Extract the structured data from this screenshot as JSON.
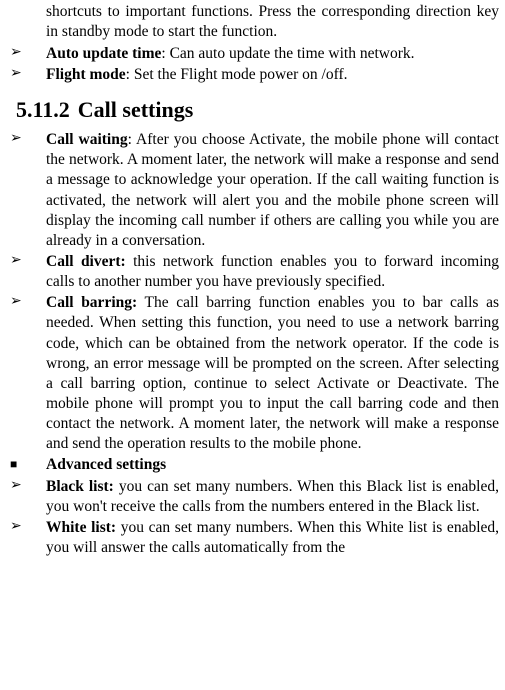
{
  "fragTop": "shortcuts to important functions. Press the corresponding direction key in standby mode to start the function.",
  "topList": [
    {
      "label": "Auto update time",
      "text": ": Can auto update the time with network."
    },
    {
      "label": "Flight mode",
      "text": ": Set the Flight mode power on /off."
    }
  ],
  "heading": {
    "num": "5.11.2",
    "title": "Call settings"
  },
  "items": [
    {
      "marker": "chev",
      "label": "Call waiting",
      "sep": ": ",
      "text": "After you choose Activate, the mobile phone will contact the network. A moment later, the network will make a response and send a message to acknowledge your operation. If the call waiting function is activated, the network will alert you and the mobile phone screen will display the incoming call number if others are calling you while you are already in a conversation."
    },
    {
      "marker": "chev",
      "label": "Call divert:",
      "sep": " ",
      "text": "this network function enables you to forward incoming calls to another number you have previously specified."
    },
    {
      "marker": "chev",
      "label": "Call barring:",
      "sep": " ",
      "text": "The call barring function enables you to bar calls as needed. When setting this function, you need to use a network barring code, which can be obtained from the network operator. If the code is wrong, an error message will be prompted on the screen. After selecting a call barring option, continue to select Activate or Deactivate. The mobile phone will prompt you to input the call barring code and then contact the network. A moment later, the network will make a response and send the operation results to the mobile phone."
    },
    {
      "marker": "square",
      "label": "Advanced settings",
      "sep": "",
      "text": ""
    },
    {
      "marker": "chev",
      "label": "Black list:",
      "sep": " ",
      "text": "you can set many numbers. When this Black list is enabled, you won't receive the calls from the numbers entered in the Black list."
    },
    {
      "marker": "chev",
      "label": "White list:",
      "sep": " ",
      "text": "you can set many numbers. When this White list is enabled, you will answer the calls automatically from the"
    }
  ]
}
